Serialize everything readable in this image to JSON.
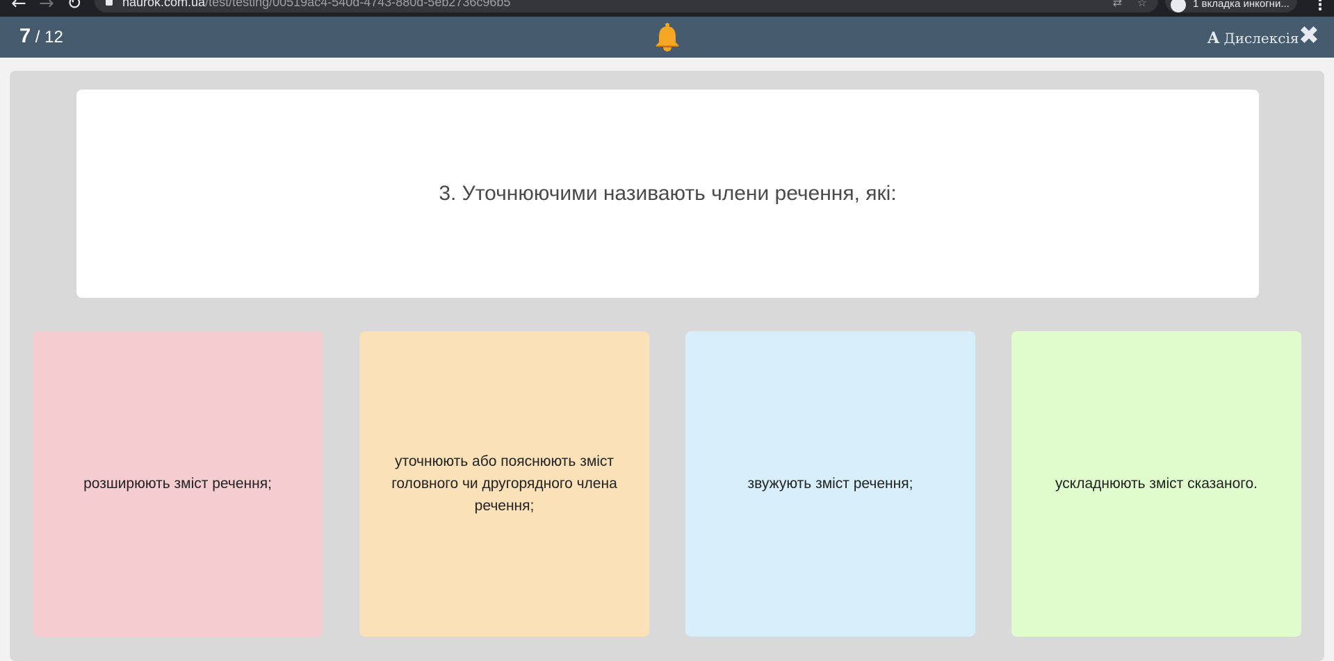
{
  "browser": {
    "url_host": "naurok.com.ua",
    "url_path": "/test/testing/00519ac4-540d-4743-880d-5eb2736c96b5",
    "incognito_label": "1 вкладка инкогни..."
  },
  "header": {
    "current_question": "7",
    "separator": " / ",
    "total_questions": "12",
    "dyslexia_letter": "A",
    "dyslexia_label": "Дислексія",
    "colors": {
      "bar": "#465b6e",
      "bell": "#f5a623"
    }
  },
  "question": {
    "text": "3. Уточнюючими називають члени речення, які:"
  },
  "answers": [
    {
      "text": "розширюють зміст речення;",
      "color": "#f5cccf"
    },
    {
      "text": "уточнюють або пояснюють зміст головного чи другорядного члена речення;",
      "color": "#fae1b7"
    },
    {
      "text": "звужують зміст речення;",
      "color": "#d7effa"
    },
    {
      "text": "ускладнюють зміст сказаного.",
      "color": "#e0fccd"
    }
  ],
  "icons": [
    "back-arrow-icon",
    "forward-arrow-icon",
    "reload-icon",
    "lock-icon",
    "translate-icon",
    "star-icon",
    "incognito-icon",
    "browser-menu-icon",
    "bell-icon",
    "close-icon"
  ]
}
